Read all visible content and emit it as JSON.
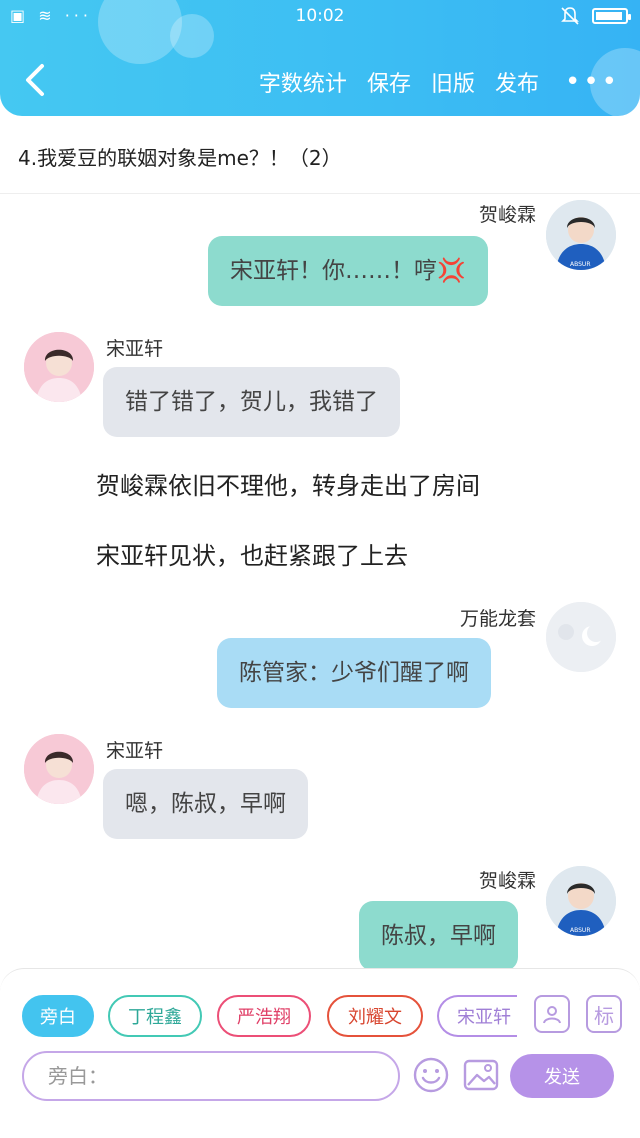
{
  "status_bar": {
    "time": "10:02",
    "left_icons": "▣ ≋ ···"
  },
  "header": {
    "nav": [
      "字数统计",
      "保存",
      "旧版",
      "发布"
    ],
    "more": "•••"
  },
  "chapter_title": "4.我爱豆的联姻对象是me？！（2）",
  "messages": [
    {
      "name": "贺峻霖",
      "text": "宋亚轩！你……！哼💢"
    },
    {
      "name": "宋亚轩",
      "text": "错了错了，贺儿，我错了"
    },
    {
      "narration": "贺峻霖依旧不理他，转身走出了房间"
    },
    {
      "narration": "宋亚轩见状，也赶紧跟了上去"
    },
    {
      "name": "万能龙套",
      "text": "陈管家：少爷们醒了啊"
    },
    {
      "name": "宋亚轩",
      "text": "嗯，陈叔，早啊"
    },
    {
      "name": "贺峻霖",
      "text": "陈叔，早啊"
    }
  ],
  "bottom": {
    "chips": [
      {
        "label": "旁白",
        "color": "#43c4ef"
      },
      {
        "label": "丁程鑫",
        "color": "#43c9b5"
      },
      {
        "label": "严浩翔",
        "color": "#ec4f77"
      },
      {
        "label": "刘耀文",
        "color": "#e5523b"
      },
      {
        "label": "宋亚轩",
        "color": "#b48ee6"
      }
    ],
    "tag_icon_label": "标",
    "input_placeholder": "旁白：",
    "send_label": "发送"
  }
}
